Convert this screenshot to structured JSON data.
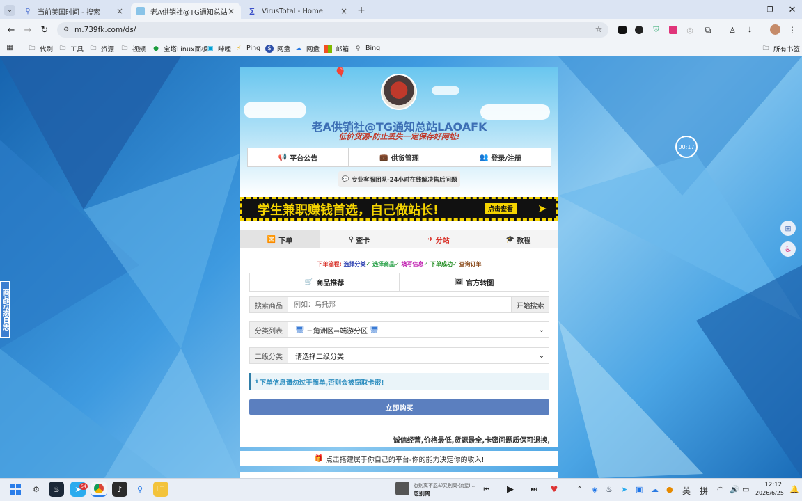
{
  "browser": {
    "tabs": [
      {
        "title": "当前美国时间 - 搜索",
        "active": false
      },
      {
        "title": "老A供销社@TG通知总站LAOA",
        "active": true
      },
      {
        "title": "VirusTotal - Home",
        "active": false
      }
    ],
    "new_tab_symbol": "+",
    "url": "m.739fk.com/ds/",
    "bookmarks": [
      "代刷",
      "工具",
      "资源",
      "视频",
      "宝塔Linux面板",
      "哔哩",
      "Ping",
      "网盘",
      "网盘",
      "邮箱",
      "Bing"
    ],
    "all_bookmarks": "所有书签"
  },
  "site": {
    "title": "老A供销社@TG通知总站LAOAFK",
    "subtitle": "低价货源-防止丢失一定保存好网址!",
    "nav": [
      "平台公告",
      "供货管理",
      "登录/注册"
    ],
    "support": "专业客服团队-24小时在线解决售后问题",
    "banner_text": "学生兼职赚钱首选，自己做站长!",
    "banner_button": "点击查看",
    "tabs": [
      "下单",
      "查卡",
      "分站",
      "教程"
    ],
    "flow": {
      "label": "下单流程:",
      "steps": [
        "选择分类",
        "选择商品",
        "填写信息",
        "下单成功",
        "查询订单"
      ]
    },
    "sub_buttons": [
      "商品推荐",
      "官方转图"
    ],
    "search": {
      "label": "搜索商品",
      "placeholder": "例如：乌托邦",
      "button": "开始搜索"
    },
    "category": {
      "label": "分类列表",
      "value": "三角洲区⇨端游分区"
    },
    "subcategory": {
      "label": "二级分类",
      "value": "请选择二级分类"
    },
    "notice": "下单信息请勿过于简单,否则会被窃取卡密!",
    "buy_button": "立即购买",
    "slogan": "诚信经营,价格最低,货源最全,卡密问题质保可退换,",
    "build_link": "点击搭建属于你自己的平台-你的能力决定你的收入!",
    "side_tab": "商品动态日志",
    "timer": "00:17"
  },
  "taskbar": {
    "badge": "54",
    "media_title": "忽别离不忍却又别离-流星i...",
    "media_artist": "忽别离",
    "ime": [
      "英",
      "拼"
    ],
    "time": "12:12",
    "date": "2026/6/25"
  },
  "colors": {
    "accent_blue": "#5b7fbf",
    "title_blue": "#3d6fb5",
    "banner_yellow": "#f5d400",
    "flow_red": "#d9342b"
  }
}
